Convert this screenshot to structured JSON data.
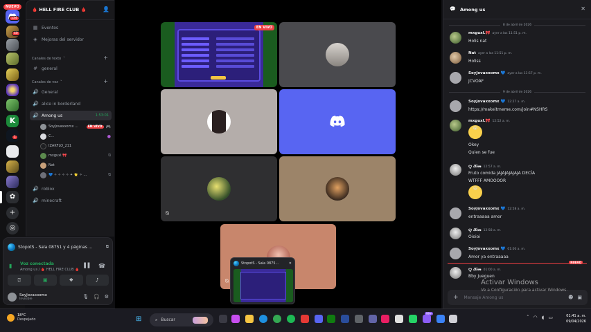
{
  "server": {
    "name": "🩸 HELL FIRE CLUB 🩸",
    "nuevo": "NUEVO",
    "dm_badge": "134",
    "rail_badges": [
      "40",
      "1"
    ]
  },
  "channels": {
    "top": [
      "Eventos",
      "Mejoras del servidor"
    ],
    "text_category": "Canales de texto",
    "text": [
      "general"
    ],
    "voice_category": "Canales de voz",
    "voice": [
      "General",
      "alice in borderland",
      "Among us",
      "roblox",
      "minecraft"
    ],
    "active_timer": "1:53:01",
    "voice_users": [
      {
        "name": "SoyJovaxxomx ...",
        "badge": "EN VIVO"
      },
      {
        "name": "C...",
        "badge": ""
      },
      {
        "name": "IZAKFLO_211",
        "badge": ""
      },
      {
        "name": "mxguxl.🎀",
        "badge": ""
      },
      {
        "name": "Nat",
        "badge": ""
      },
      {
        "name": "💙 ✧ ✧ ✧ ✧ ✦ ⭐ ✧ ✨ 🌊",
        "badge": ""
      }
    ]
  },
  "panel": {
    "stream_title": "StopotS - Sala 08751 y 4 páginas ...",
    "voice_status": "Voz conectada",
    "voice_location": "Among us / 🩸 HELL FIRE CLUB 🩸",
    "username": "SoyJovaxxomx",
    "user_status": "Invisible"
  },
  "stage": {
    "live_label": "EN VIVO",
    "pip_title": "StopotS - Sala 0875..."
  },
  "chat": {
    "title": "Among us",
    "date1": "8 de abril de 2026",
    "date2": "9 de abril de 2026",
    "new_label": "NUEVO",
    "input_placeholder": "Mensaje Among us",
    "messages": [
      {
        "name": "mxguxl.🎀",
        "time": "ayer a las 11:51 p. m.",
        "text": "Holis nat"
      },
      {
        "name": "Nat",
        "time": "ayer a las 11:51 p. m.",
        "text": "Holiss"
      },
      {
        "name": "SoyJovaxxomx 💙",
        "time": "ayer a las 11:57 p. m.",
        "text": "JCVOAF"
      },
      {
        "name": "SoyJovaxxomx 💙",
        "time": "12:27 a. m.",
        "text": "https://makeitmeme.com/join#NSHRS"
      },
      {
        "name": "mxguxl.🎀",
        "time": "12:52 a. m.",
        "text": "😭",
        "text2": "Okey",
        "text3": "Quien se fue"
      },
      {
        "name": "ꨄ 𝒦𝒾𝓂",
        "time": "12:57 a. m.",
        "text": "Fruto comida JAJAJAJAJAJA DECÍA",
        "text2": "WTFFF AMOOOOR",
        "text3": "😆"
      },
      {
        "name": "SoyJovaxxomx 💙",
        "time": "12:58 a. m.",
        "text": "entraaaaa amor"
      },
      {
        "name": "ꨄ 𝒦𝒾𝓂",
        "time": "12:58 a. m.",
        "text": "Oioioi"
      },
      {
        "name": "SoyJovaxxomx 💙",
        "time": "01:00 a. m.",
        "text": "Amor ya entraaaaa"
      },
      {
        "name": "ꨄ 𝒦𝒾𝓂",
        "time": "01:00 a. m.",
        "text": "Bby Jueguen"
      }
    ],
    "activate_title": "Activar Windows",
    "activate_sub": "Ve a Configuración para activar Windows."
  },
  "taskbar": {
    "temp": "18°C",
    "weather": "Despejado",
    "search": "Buscar",
    "time": "01:41 a. m.",
    "date": "09/04/2026",
    "badge": "99+"
  },
  "colors": {
    "accent": "#5865f2",
    "live": "#ed4245",
    "online": "#23a55a",
    "link": "#00a8fc"
  }
}
